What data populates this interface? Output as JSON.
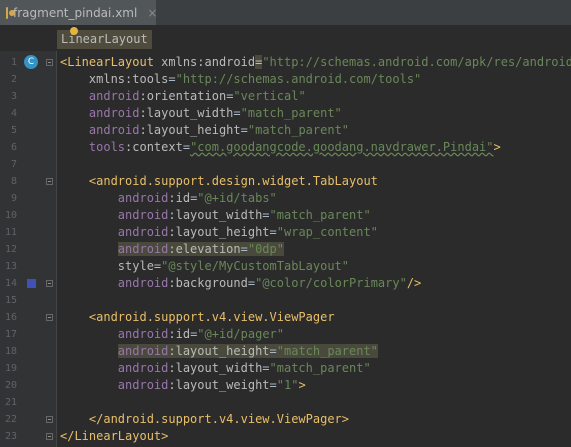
{
  "tab": {
    "file_name": "fragment_pindai.xml",
    "close_label": "×"
  },
  "breadcrumb": {
    "label": "LinearLayout"
  },
  "gutter": {
    "class_icon_label": "C",
    "color_swatch": "#3f51b5"
  },
  "line_numbers": [
    "1",
    "2",
    "3",
    "4",
    "5",
    "6",
    "7",
    "8",
    "9",
    "10",
    "11",
    "12",
    "13",
    "14",
    "15",
    "16",
    "17",
    "18",
    "19",
    "20",
    "21",
    "22",
    "23"
  ],
  "code": {
    "l1_open": "<LinearLayout ",
    "l1_attr": "xmlns:android",
    "l1_eq": "=",
    "l1_val": "\"http://schemas.android.com/apk/res/android\"",
    "l2_attr": "xmlns:tools",
    "l2_val": "\"http://schemas.android.com/tools\"",
    "l3_ns": "android",
    "l3_attr": ":orientation",
    "l3_val": "\"vertical\"",
    "l4_ns": "android",
    "l4_attr": ":layout_width",
    "l4_val": "\"match_parent\"",
    "l5_ns": "android",
    "l5_attr": ":layout_height",
    "l5_val": "\"match_parent\"",
    "l6_ns": "tools",
    "l6_attr": ":context",
    "l6_val": "\"com.goodangcode.goodang.navdrawer.Pindai\"",
    "l6_close": ">",
    "l8_tag": "<android.support.design.widget.TabLayout",
    "l9_ns": "android",
    "l9_attr": ":id",
    "l9_val": "\"@+id/tabs\"",
    "l10_ns": "android",
    "l10_attr": ":layout_width",
    "l10_val": "\"match_parent\"",
    "l11_ns": "android",
    "l11_attr": ":layout_height",
    "l11_val": "\"wrap_content\"",
    "l12_ns": "android",
    "l12_attr": ":elevation",
    "l12_val": "\"0dp\"",
    "l13_attr": "style",
    "l13_val": "\"@style/MyCustomTabLayout\"",
    "l14_ns": "android",
    "l14_attr": ":background",
    "l14_val": "\"@color/colorPrimary\"",
    "l14_close": "/>",
    "l16_tag": "<android.support.v4.view.ViewPager",
    "l17_ns": "android",
    "l17_attr": ":id",
    "l17_val": "\"@+id/pager\"",
    "l18_ns": "android",
    "l18_attr": ":layout_height",
    "l18_val": "\"match_parent\"",
    "l19_ns": "android",
    "l19_attr": ":layout_width",
    "l19_val": "\"match_parent\"",
    "l20_ns": "android",
    "l20_attr": ":layout_weight",
    "l20_val": "\"1\"",
    "l20_close": ">",
    "l22_tag": "</android.support.v4.view.ViewPager>",
    "l23_tag": "</LinearLayout>"
  }
}
